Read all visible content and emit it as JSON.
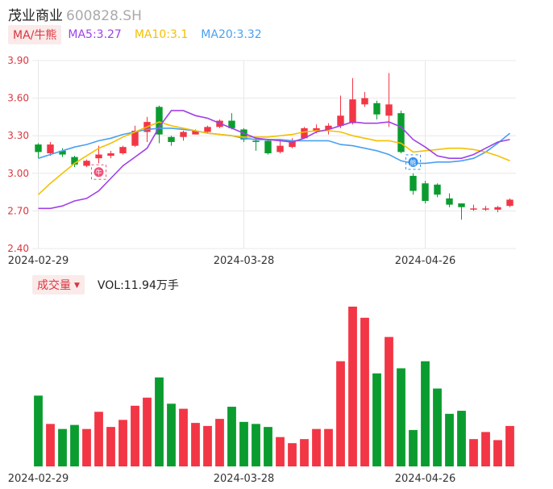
{
  "header": {
    "name": "茂业商业",
    "code": "600828.SH"
  },
  "ma_legend": {
    "badge": "MA/牛熊",
    "ma5": "MA5:3.27",
    "ma10": "MA10:3.1",
    "ma20": "MA20:3.32"
  },
  "volume_legend": {
    "badge": "成交量",
    "vol": "VOL:11.94万手"
  },
  "colors": {
    "up": "#f23645",
    "down": "#0b9c2f",
    "ma5": "#a040e8",
    "ma10": "#f5c000",
    "ma20": "#4aa0f0",
    "grid": "#e8e8e8",
    "axis_text": "#d9363e"
  },
  "icons": {
    "bull_marker": "bull-icon",
    "bear_marker": "bear-icon"
  },
  "chart_data": [
    {
      "type": "candlestick",
      "y_ticks": [
        "3.90",
        "3.60",
        "3.30",
        "3.00",
        "2.70",
        "2.40"
      ],
      "ylim": [
        2.4,
        3.9
      ],
      "x_tick_labels": [
        {
          "label": "2024-02-29",
          "index": 0
        },
        {
          "label": "2024-03-28",
          "index": 17
        },
        {
          "label": "2024-04-26",
          "index": 32
        }
      ],
      "candles": [
        {
          "o": 3.23,
          "c": 3.17,
          "h": 3.24,
          "l": 3.12
        },
        {
          "o": 3.16,
          "c": 3.23,
          "h": 3.25,
          "l": 3.14
        },
        {
          "o": 3.18,
          "c": 3.15,
          "h": 3.2,
          "l": 3.13
        },
        {
          "o": 3.13,
          "c": 3.07,
          "h": 3.14,
          "l": 3.05
        },
        {
          "o": 3.06,
          "c": 3.1,
          "h": 3.11,
          "l": 3.05
        },
        {
          "o": 3.12,
          "c": 3.15,
          "h": 3.22,
          "l": 3.08
        },
        {
          "o": 3.14,
          "c": 3.16,
          "h": 3.18,
          "l": 3.12
        },
        {
          "o": 3.16,
          "c": 3.21,
          "h": 3.22,
          "l": 3.15
        },
        {
          "o": 3.22,
          "c": 3.34,
          "h": 3.38,
          "l": 3.21
        },
        {
          "o": 3.33,
          "c": 3.41,
          "h": 3.45,
          "l": 3.25
        },
        {
          "o": 3.53,
          "c": 3.31,
          "h": 3.54,
          "l": 3.24
        },
        {
          "o": 3.29,
          "c": 3.25,
          "h": 3.3,
          "l": 3.22
        },
        {
          "o": 3.29,
          "c": 3.33,
          "h": 3.34,
          "l": 3.26
        },
        {
          "o": 3.31,
          "c": 3.34,
          "h": 3.35,
          "l": 3.31
        },
        {
          "o": 3.33,
          "c": 3.37,
          "h": 3.38,
          "l": 3.32
        },
        {
          "o": 3.37,
          "c": 3.42,
          "h": 3.43,
          "l": 3.36
        },
        {
          "o": 3.42,
          "c": 3.36,
          "h": 3.48,
          "l": 3.35
        },
        {
          "o": 3.35,
          "c": 3.27,
          "h": 3.36,
          "l": 3.25
        },
        {
          "o": 3.26,
          "c": 3.25,
          "h": 3.27,
          "l": 3.18
        },
        {
          "o": 3.26,
          "c": 3.16,
          "h": 3.27,
          "l": 3.15
        },
        {
          "o": 3.17,
          "c": 3.22,
          "h": 3.27,
          "l": 3.16
        },
        {
          "o": 3.21,
          "c": 3.26,
          "h": 3.28,
          "l": 3.2
        },
        {
          "o": 3.28,
          "c": 3.36,
          "h": 3.37,
          "l": 3.28
        },
        {
          "o": 3.34,
          "c": 3.36,
          "h": 3.39,
          "l": 3.32
        },
        {
          "o": 3.35,
          "c": 3.38,
          "h": 3.4,
          "l": 3.31
        },
        {
          "o": 3.38,
          "c": 3.46,
          "h": 3.62,
          "l": 3.36
        },
        {
          "o": 3.4,
          "c": 3.59,
          "h": 3.76,
          "l": 3.39
        },
        {
          "o": 3.55,
          "c": 3.6,
          "h": 3.65,
          "l": 3.53
        },
        {
          "o": 3.56,
          "c": 3.47,
          "h": 3.58,
          "l": 3.43
        },
        {
          "o": 3.46,
          "c": 3.55,
          "h": 3.8,
          "l": 3.37
        },
        {
          "o": 3.48,
          "c": 3.17,
          "h": 3.5,
          "l": 3.16
        },
        {
          "o": 2.98,
          "c": 2.86,
          "h": 3.0,
          "l": 2.83
        },
        {
          "o": 2.92,
          "c": 2.78,
          "h": 2.94,
          "l": 2.76
        },
        {
          "o": 2.91,
          "c": 2.83,
          "h": 2.92,
          "l": 2.81
        },
        {
          "o": 2.8,
          "c": 2.75,
          "h": 2.84,
          "l": 2.73
        },
        {
          "o": 2.76,
          "c": 2.73,
          "h": 2.76,
          "l": 2.63
        },
        {
          "o": 2.72,
          "c": 2.72,
          "h": 2.75,
          "l": 2.7
        },
        {
          "o": 2.72,
          "c": 2.72,
          "h": 2.74,
          "l": 2.7
        },
        {
          "o": 2.71,
          "c": 2.73,
          "h": 2.74,
          "l": 2.69
        },
        {
          "o": 2.74,
          "c": 2.79,
          "h": 2.8,
          "l": 2.73
        }
      ],
      "ma5": [
        2.72,
        2.72,
        2.74,
        2.78,
        2.8,
        2.86,
        2.96,
        3.06,
        3.13,
        3.2,
        3.37,
        3.5,
        3.5,
        3.46,
        3.44,
        3.4,
        3.36,
        3.32,
        3.28,
        3.27,
        3.26,
        3.25,
        3.28,
        3.33,
        3.35,
        3.38,
        3.41,
        3.4,
        3.4,
        3.41,
        3.37,
        3.27,
        3.21,
        3.14,
        3.12,
        3.12,
        3.15,
        3.2,
        3.25,
        3.27
      ],
      "ma10": [
        2.83,
        2.92,
        3.0,
        3.08,
        3.14,
        3.2,
        3.24,
        3.29,
        3.33,
        3.37,
        3.41,
        3.38,
        3.36,
        3.34,
        3.32,
        3.31,
        3.3,
        3.29,
        3.29,
        3.29,
        3.3,
        3.31,
        3.33,
        3.34,
        3.34,
        3.33,
        3.3,
        3.28,
        3.26,
        3.26,
        3.24,
        3.17,
        3.18,
        3.19,
        3.2,
        3.2,
        3.19,
        3.17,
        3.14,
        3.1
      ],
      "ma20": [
        3.12,
        3.15,
        3.18,
        3.21,
        3.23,
        3.26,
        3.28,
        3.31,
        3.33,
        3.35,
        3.36,
        3.36,
        3.35,
        3.34,
        3.32,
        3.31,
        3.3,
        3.28,
        3.27,
        3.27,
        3.27,
        3.26,
        3.26,
        3.26,
        3.26,
        3.23,
        3.22,
        3.2,
        3.18,
        3.15,
        3.1,
        3.08,
        3.08,
        3.09,
        3.09,
        3.1,
        3.12,
        3.17,
        3.24,
        3.32
      ],
      "volume": [
        70,
        42,
        37,
        41,
        37,
        54,
        39,
        46,
        60,
        68,
        88,
        62,
        57,
        43,
        40,
        47,
        59,
        44,
        42,
        39,
        29,
        23,
        27,
        37,
        37,
        104,
        158,
        147,
        92,
        128,
        97,
        36,
        104,
        77,
        52,
        55,
        27,
        34,
        26,
        40
      ]
    }
  ]
}
